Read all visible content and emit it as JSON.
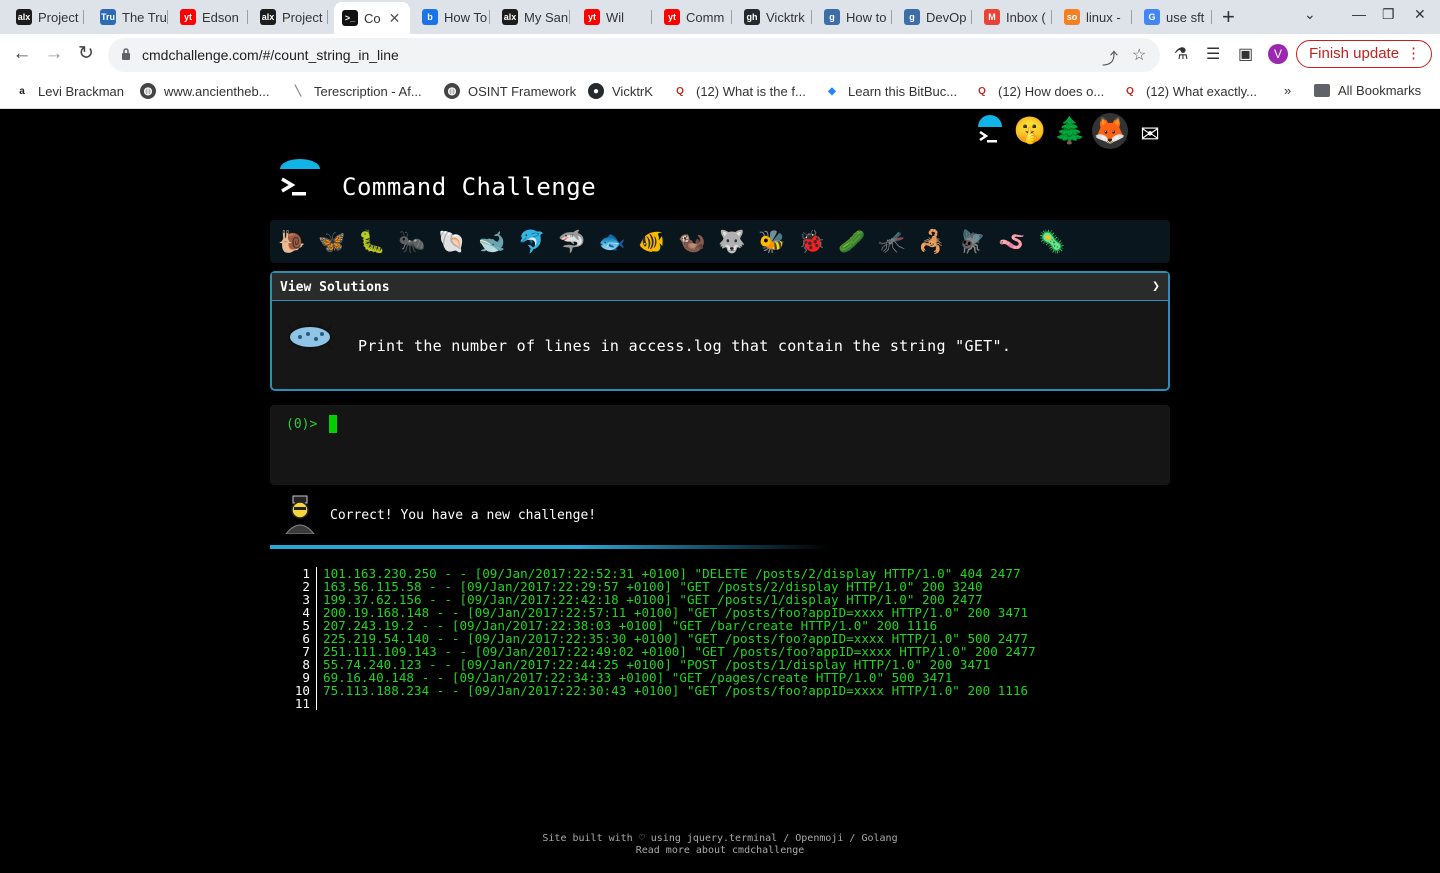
{
  "browser": {
    "tabs": [
      {
        "label": "Project",
        "fav": "alx",
        "fav_color": "#1c1c1c"
      },
      {
        "label": "The Tru",
        "fav": "Tru",
        "fav_color": "#2c6bb3"
      },
      {
        "label": "Edson",
        "fav": "yt",
        "fav_color": "#ff0000"
      },
      {
        "label": "Project",
        "fav": "alx",
        "fav_color": "#1c1c1c"
      },
      {
        "label": "Co",
        "fav": ">_",
        "fav_color": "#111111"
      },
      {
        "label": "How To",
        "fav": "b",
        "fav_color": "#1a73e8"
      },
      {
        "label": "My San",
        "fav": "alx",
        "fav_color": "#1c1c1c"
      },
      {
        "label": "Wil",
        "fav": "yt",
        "fav_color": "#ff0000"
      },
      {
        "label": "Comm",
        "fav": "yt",
        "fav_color": "#ff0000"
      },
      {
        "label": "Vicktrk",
        "fav": "gh",
        "fav_color": "#24292e"
      },
      {
        "label": "How to",
        "fav": "g",
        "fav_color": "#3b6ea8"
      },
      {
        "label": "DevOp",
        "fav": "g",
        "fav_color": "#3b6ea8"
      },
      {
        "label": "Inbox (",
        "fav": "M",
        "fav_color": "#ea4335"
      },
      {
        "label": "linux -",
        "fav": "so",
        "fav_color": "#f48024"
      },
      {
        "label": "use sft",
        "fav": "G",
        "fav_color": "#4285f4"
      }
    ],
    "url": "cmdchallenge.com/#/count_string_in_line",
    "profile_initial": "V",
    "finish_update": "Finish update",
    "bookmarks": [
      {
        "label": "Levi Brackman",
        "icon": "alx"
      },
      {
        "label": "www.ancientheb...",
        "icon": "globe"
      },
      {
        "label": "Terescription - Af...",
        "icon": "slash"
      },
      {
        "label": "OSINT Framework",
        "icon": "globe"
      },
      {
        "label": "VicktrK",
        "icon": "gh"
      },
      {
        "label": "(12) What is the f...",
        "icon": "Q"
      },
      {
        "label": "Learn this BitBuc...",
        "icon": "bb"
      },
      {
        "label": "(12) How does o...",
        "icon": "Q"
      },
      {
        "label": "(12) What exactly...",
        "icon": "Q"
      }
    ],
    "all_bookmarks": "All Bookmarks"
  },
  "site": {
    "title": "Command Challenge",
    "view_solutions": "View Solutions",
    "challenge_text": "Print the number of lines in access.log that contain the string \"GET\".",
    "prompt": "(0)>",
    "feedback": "Correct! You have a new challenge!",
    "footer_line1": "Site built with ♡ using jquery.terminal / Openmoji / Golang",
    "footer_line2": "Read more about cmdchallenge",
    "log_lines": [
      {
        "n": "1",
        "text": "101.163.230.250 - - [09/Jan/2017:22:52:31 +0100] \"DELETE /posts/2/display HTTP/1.0\" 404 2477"
      },
      {
        "n": "2",
        "text": "163.56.115.58 - - [09/Jan/2017:22:29:57 +0100] \"GET /posts/2/display HTTP/1.0\" 200 3240"
      },
      {
        "n": "3",
        "text": "199.37.62.156 - - [09/Jan/2017:22:42:18 +0100] \"GET /posts/1/display HTTP/1.0\" 200 2477"
      },
      {
        "n": "4",
        "text": "200.19.168.148 - - [09/Jan/2017:22:57:11 +0100] \"GET /posts/foo?appID=xxxx HTTP/1.0\" 200 3471"
      },
      {
        "n": "5",
        "text": "207.243.19.2 - - [09/Jan/2017:22:38:03 +0100] \"GET /bar/create HTTP/1.0\" 200 1116"
      },
      {
        "n": "6",
        "text": "225.219.54.140 - - [09/Jan/2017:22:35:30 +0100] \"GET /posts/foo?appID=xxxx HTTP/1.0\" 500 2477"
      },
      {
        "n": "7",
        "text": "251.111.109.143 - - [09/Jan/2017:22:49:02 +0100] \"GET /posts/foo?appID=xxxx HTTP/1.0\" 200 2477"
      },
      {
        "n": "8",
        "text": "55.74.240.123 - - [09/Jan/2017:22:44:25 +0100] \"POST /posts/1/display HTTP/1.0\" 200 3471"
      },
      {
        "n": "9",
        "text": "69.16.40.148 - - [09/Jan/2017:22:34:33 +0100] \"GET /pages/create HTTP/1.0\" 500 3471"
      },
      {
        "n": "10",
        "text": "75.113.188.234 - - [09/Jan/2017:22:30:43 +0100] \"GET /posts/foo?appID=xxxx HTTP/1.0\" 200 1116"
      },
      {
        "n": "11",
        "text": ""
      }
    ],
    "level_icons": [
      {
        "name": "snail",
        "glyph": "🐌"
      },
      {
        "name": "butterfly",
        "glyph": "🦋"
      },
      {
        "name": "caterpillar",
        "glyph": "🐛"
      },
      {
        "name": "ant",
        "glyph": "🐜"
      },
      {
        "name": "shell",
        "glyph": "🐚"
      },
      {
        "name": "whale",
        "glyph": "🐋"
      },
      {
        "name": "dolphin",
        "glyph": "🐬"
      },
      {
        "name": "shark",
        "glyph": "🦈"
      },
      {
        "name": "fish",
        "glyph": "🐟"
      },
      {
        "name": "tropical-fish",
        "glyph": "🐠"
      },
      {
        "name": "otter",
        "glyph": "🦦"
      },
      {
        "name": "wolf",
        "glyph": "🐺"
      },
      {
        "name": "bee",
        "glyph": "🐝"
      },
      {
        "name": "ladybug",
        "glyph": "🐞"
      },
      {
        "name": "cucumber",
        "glyph": "🥒"
      },
      {
        "name": "mosquito",
        "glyph": "🦟"
      },
      {
        "name": "scorpion",
        "glyph": "🦂"
      },
      {
        "name": "fly",
        "glyph": "🪰"
      },
      {
        "name": "worm",
        "glyph": "🪱"
      },
      {
        "name": "microbe",
        "glyph": "🦠"
      }
    ]
  }
}
